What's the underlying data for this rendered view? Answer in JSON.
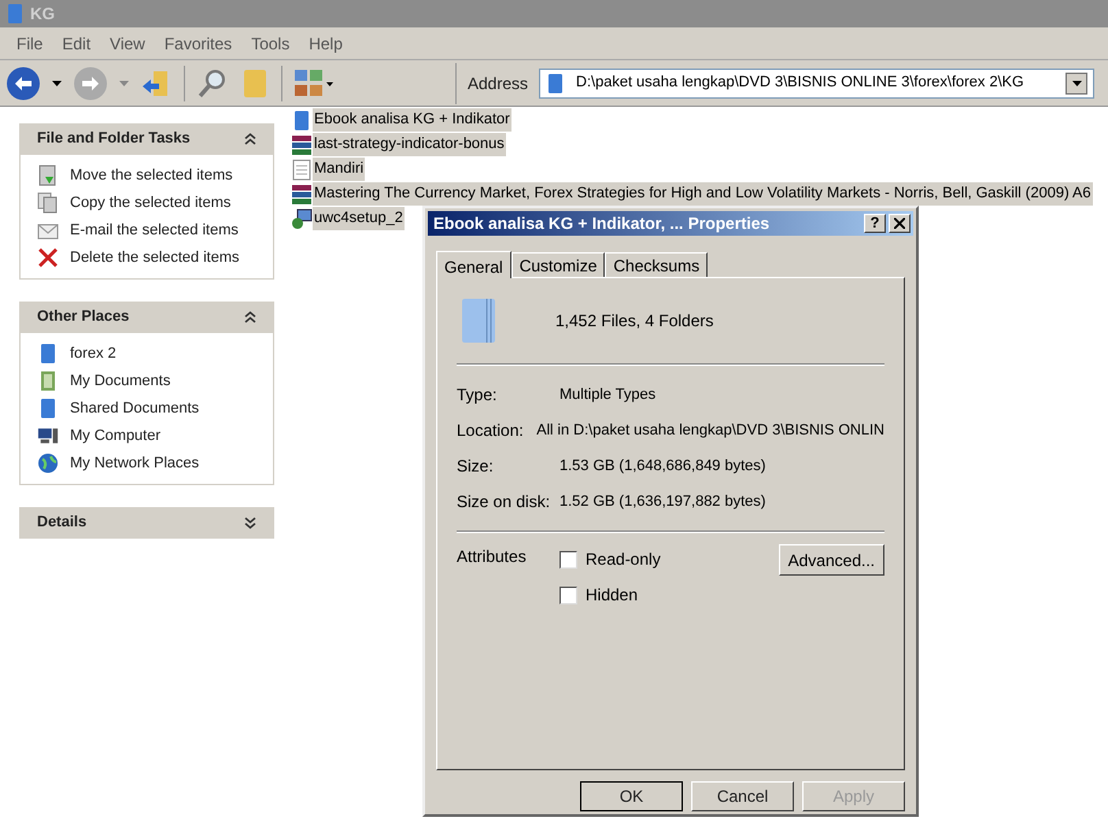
{
  "window": {
    "title": "KG"
  },
  "menu": [
    "File",
    "Edit",
    "View",
    "Favorites",
    "Tools",
    "Help"
  ],
  "address": {
    "label": "Address",
    "value": "D:\\paket usaha lengkap\\DVD 3\\BISNIS ONLINE 3\\forex\\forex 2\\KG"
  },
  "panels": [
    {
      "title": "File and Folder Tasks",
      "expanded": true,
      "items": [
        {
          "label": "Move the selected items",
          "kind": "move"
        },
        {
          "label": "Copy the selected items",
          "kind": "copy"
        },
        {
          "label": "E-mail the selected items",
          "kind": "mail"
        },
        {
          "label": "Delete the selected items",
          "kind": "delete"
        }
      ]
    },
    {
      "title": "Other Places",
      "expanded": true,
      "items": [
        {
          "label": "forex 2",
          "kind": "folder"
        },
        {
          "label": "My Documents",
          "kind": "documents"
        },
        {
          "label": "Shared Documents",
          "kind": "folder"
        },
        {
          "label": "My Computer",
          "kind": "computer"
        },
        {
          "label": "My Network Places",
          "kind": "network"
        }
      ]
    },
    {
      "title": "Details",
      "expanded": false
    }
  ],
  "files": [
    {
      "name": "Ebook analisa KG + Indikator",
      "kind": "folder",
      "selected": true
    },
    {
      "name": "last-strategy-indicator-bonus",
      "kind": "archive",
      "selected": true
    },
    {
      "name": "Mandiri",
      "kind": "text",
      "selected": true
    },
    {
      "name": "Mastering The Currency Market, Forex Strategies for High and Low Volatility Markets - Norris, Bell, Gaskill (2009) A6",
      "kind": "archive",
      "selected": true
    },
    {
      "name": "uwc4setup_2",
      "kind": "installer",
      "selected": true
    }
  ],
  "dialog": {
    "title": "Ebook analisa KG + Indikator, ... Properties",
    "help": "?",
    "tabs": [
      {
        "label": "General",
        "selected": true
      },
      {
        "label": "Customize",
        "selected": false
      },
      {
        "label": "Checksums",
        "selected": false
      }
    ],
    "summary": "1,452 Files, 4 Folders",
    "properties": [
      {
        "label": "Type:",
        "value": "Multiple Types"
      },
      {
        "label": "Location:",
        "value": "All in D:\\paket usaha lengkap\\DVD 3\\BISNIS ONLIN"
      },
      {
        "label": "Size:",
        "value": "1.53 GB (1,648,686,849 bytes)"
      },
      {
        "label": "Size on disk:",
        "value": "1.52 GB (1,636,197,882 bytes)"
      }
    ],
    "attributes_label": "Attributes",
    "attributes": [
      {
        "label": "Read-only",
        "checked": false
      },
      {
        "label": "Hidden",
        "checked": false
      }
    ],
    "advanced": "Advanced...",
    "buttons": [
      {
        "label": "OK",
        "disabled": false,
        "default": true
      },
      {
        "label": "Cancel",
        "disabled": false,
        "default": false
      },
      {
        "label": "Apply",
        "disabled": true,
        "default": false
      }
    ]
  }
}
